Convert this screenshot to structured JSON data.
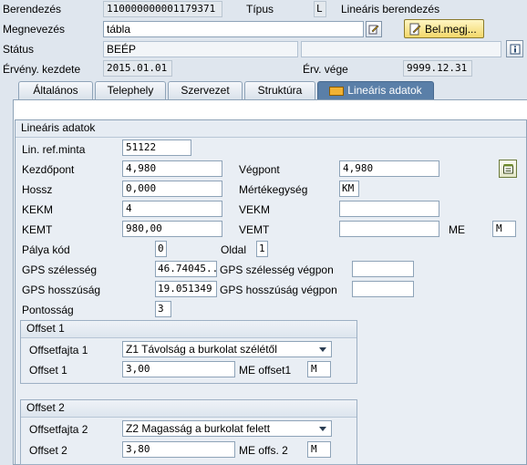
{
  "header": {
    "berendezes_label": "Berendezés",
    "berendezes_value": "110000000001179371",
    "tipus_label": "Típus",
    "tipus_value": "L",
    "tipus_desc": "Lineáris berendezés",
    "megnevezes_label": "Megnevezés",
    "megnevezes_value": "tábla",
    "belmegj_label": "Bel.megj...",
    "status_label": "Státus",
    "status_value": "BEÉP",
    "erveny_kezdete_label": "Érvény. kezdete",
    "erveny_kezdete_value": "2015.01.01",
    "erv_vege_label": "Érv. vége",
    "erv_vege_value": "9999.12.31"
  },
  "tabs": [
    {
      "label": "Általános",
      "active": false
    },
    {
      "label": "Telephely",
      "active": false
    },
    {
      "label": "Szervezet",
      "active": false
    },
    {
      "label": "Struktúra",
      "active": false
    },
    {
      "label": "Lineáris adatok",
      "active": true
    }
  ],
  "linear": {
    "group_title": "Lineáris adatok",
    "lin_ref_minta_label": "Lin. ref.minta",
    "lin_ref_minta_value": "51122",
    "kezdopont_label": "Kezdőpont",
    "kezdopont_value": "4,980",
    "vegpont_label": "Végpont",
    "vegpont_value": "4,980",
    "hossz_label": "Hossz",
    "hossz_value": "0,000",
    "mertekegyseg_label": "Mértékegység",
    "mertekegyseg_value": "KM",
    "kekm_label": "KEKM",
    "kekm_value": "4",
    "vekm_label": "VEKM",
    "vekm_value": "",
    "kemt_label": "KEMT",
    "kemt_value": "980,00",
    "vemt_label": "VEMT",
    "vemt_value": "",
    "me_label": "ME",
    "me_value": "M",
    "palya_kod_label": "Pálya kód",
    "palya_kod_value": "0",
    "oldal_label": "Oldal",
    "oldal_value": "1",
    "gps_szel_label": "GPS szélesség",
    "gps_szel_value": "46.74045...",
    "gps_szel_veg_label": "GPS szélesség végpon",
    "gps_szel_veg_value": "",
    "gps_hossz_label": "GPS hosszúság",
    "gps_hossz_value": "19.051349",
    "gps_hossz_veg_label": "GPS hosszúság végpon",
    "gps_hossz_veg_value": "",
    "pontossag_label": "Pontosság",
    "pontossag_value": "3"
  },
  "offset1": {
    "title": "Offset 1",
    "fajta_label": "Offsetfajta 1",
    "fajta_value": "Z1 Távolság a burkolat szélétől",
    "offset_label": "Offset 1",
    "offset_value": "3,00",
    "me_label": "ME offset1",
    "me_value": "M"
  },
  "offset2": {
    "title": "Offset 2",
    "fajta_label": "Offsetfajta 2",
    "fajta_value": "Z2 Magasság a burkolat felett",
    "offset_label": "Offset 2",
    "offset_value": "3,80",
    "me_label": "ME offs. 2",
    "me_value": "M"
  },
  "icons": [
    "edit-icon",
    "note-icon",
    "info-icon",
    "linear-data-icon",
    "measure-icon"
  ],
  "colors": {
    "background": "#dfe6ee",
    "active_tab": "#5a7fa8",
    "field_border": "#8ea3b8"
  }
}
